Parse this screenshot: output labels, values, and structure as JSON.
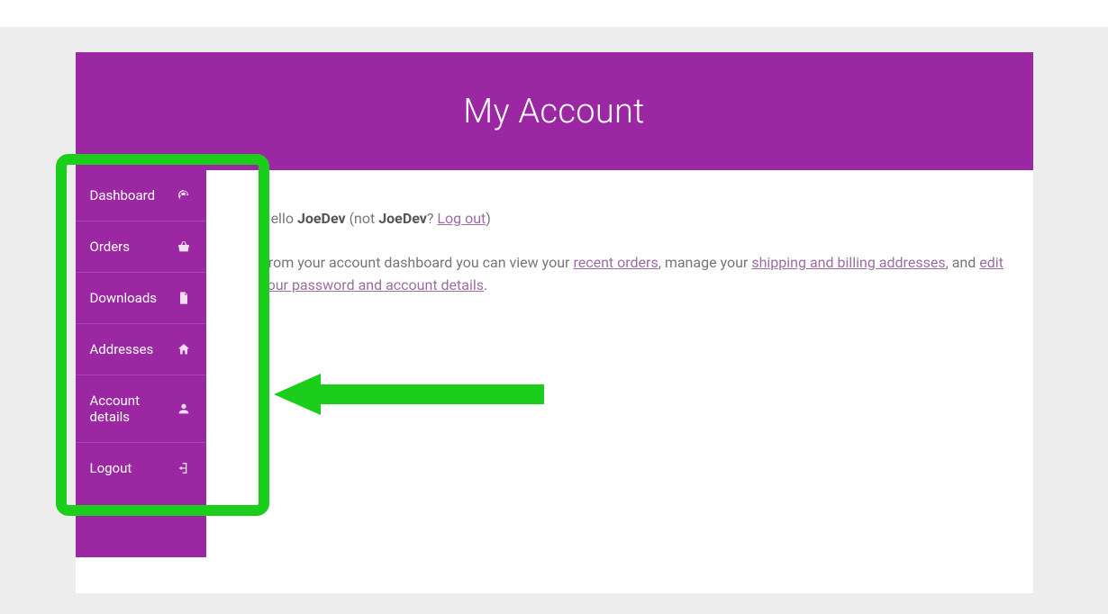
{
  "header": {
    "title": "My Account"
  },
  "sidebar": {
    "items": [
      {
        "label": "Dashboard",
        "icon": "dashboard-icon"
      },
      {
        "label": "Orders",
        "icon": "basket-icon"
      },
      {
        "label": "Downloads",
        "icon": "file-icon"
      },
      {
        "label": "Addresses",
        "icon": "home-icon"
      },
      {
        "label": "Account details",
        "icon": "user-icon"
      },
      {
        "label": "Logout",
        "icon": "signout-icon"
      }
    ]
  },
  "content": {
    "greeting_prefix": "Hello ",
    "username": "JoeDev",
    "not_prefix": " (not ",
    "username2": "JoeDev",
    "not_suffix": "? ",
    "logout_link": "Log out",
    "greeting_close": ")",
    "dashboard_text_1": "From your account dashboard you can view your ",
    "recent_orders_link": "recent orders",
    "dashboard_text_2": ", manage your ",
    "addresses_link": "shipping and billing addresses",
    "dashboard_text_3": ", and ",
    "edit_account_link": "edit your password and account details",
    "dashboard_text_4": "."
  }
}
